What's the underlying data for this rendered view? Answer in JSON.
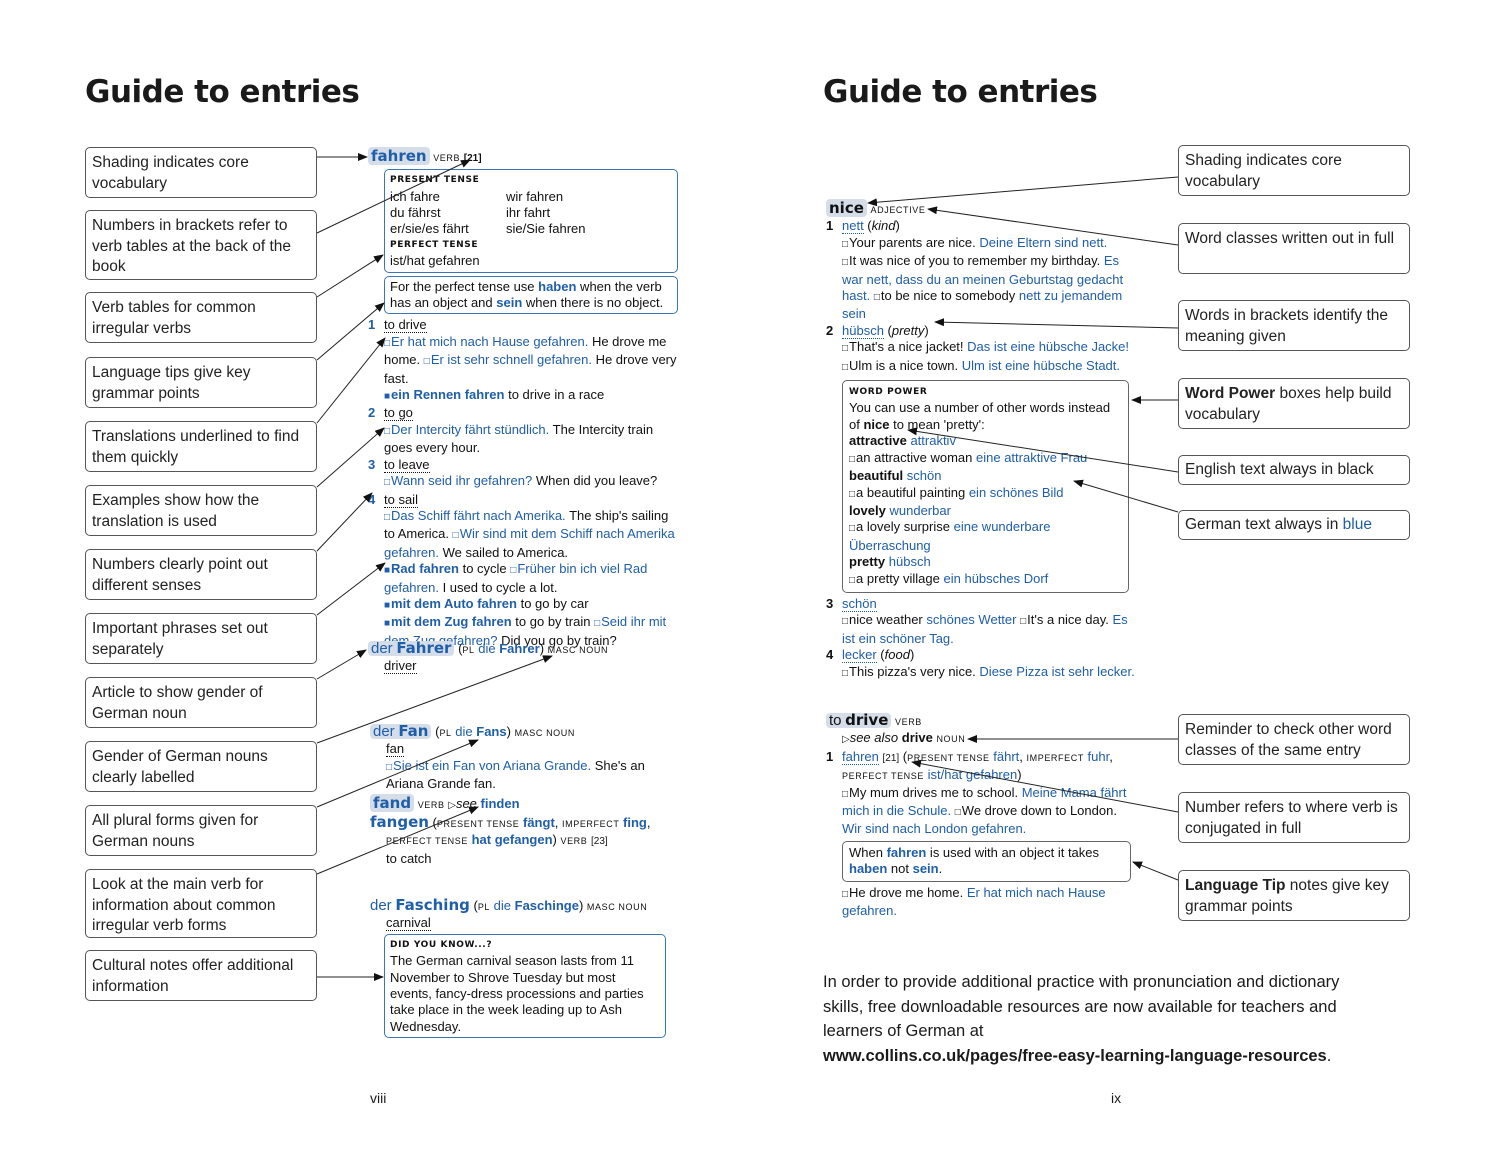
{
  "left_page": {
    "title": "Guide to entries",
    "page_number": "viii",
    "callouts": [
      "Shading indicates core vocabulary",
      "Numbers in brackets refer to verb tables at  the back of the book",
      "Verb tables for common irregular verbs",
      "Language tips give key grammar points",
      "Translations underlined to find them quickly",
      "Examples show how the translation is used",
      "Numbers clearly point out different senses",
      "Important phrases set out separately",
      "Article to show gender of German noun",
      "Gender of German nouns clearly labelled",
      "All plural forms given for German nouns",
      "Look at the main verb for information about common irregular verb forms",
      "Cultural notes offer additional information"
    ],
    "fahren": {
      "headword": "fahren",
      "pos": "VERB",
      "table_ref": "[21]",
      "present_label": "PRESENT TENSE",
      "present": [
        [
          "ich fahre",
          "wir fahren"
        ],
        [
          "du fährst",
          "ihr fahrt"
        ],
        [
          "er/sie/es fährt",
          "sie/Sie fahren"
        ]
      ],
      "perfect_label": "PERFECT TENSE",
      "perfect": "ist/hat gefahren",
      "tip": [
        "For the perfect tense use ",
        "haben",
        " when the verb has an object and ",
        "sein",
        " when there is no object."
      ],
      "senses": [
        {
          "n": "1",
          "tr": "to drive",
          "ex": [
            [
              "Er hat mich nach Hause gefahren.",
              "He drove me home."
            ],
            [
              "Er ist sehr schnell gefahren.",
              "He drove very fast."
            ]
          ],
          "phr": [
            [
              "ein Rennen fahren",
              "to drive in a race"
            ]
          ]
        },
        {
          "n": "2",
          "tr": "to go",
          "ex": [
            [
              "Der Intercity fährt stündlich.",
              "The Intercity train goes every hour."
            ]
          ]
        },
        {
          "n": "3",
          "tr": "to leave",
          "ex": [
            [
              "Wann seid ihr gefahren?",
              "When did you leave?"
            ]
          ]
        },
        {
          "n": "4",
          "tr": "to sail",
          "ex": [
            [
              "Das Schiff fährt nach Amerika.",
              "The ship's sailing to America."
            ],
            [
              "Wir sind mit dem Schiff nach Amerika gefahren.",
              "We sailed to America."
            ]
          ]
        }
      ],
      "phrases": [
        {
          "de": "Rad fahren",
          "en": "to cycle",
          "ex_de": "Früher bin ich viel Rad gefahren.",
          "ex_en": "I used to cycle a lot."
        },
        {
          "de": "mit dem Auto fahren",
          "en": "to go by car"
        },
        {
          "de": "mit dem Zug fahren",
          "en": "to go by train",
          "ex_de": "Seid ihr mit dem Zug gefahren?",
          "ex_en": "Did you go by train?"
        }
      ]
    },
    "fahrer": {
      "article": "der",
      "headword": "Fahrer",
      "pl_label": "PL",
      "pl": "die",
      "pl_word": "Fahrer",
      "gender": "MASC NOUN",
      "tr": "driver"
    },
    "fan": {
      "article": "der",
      "headword": "Fan",
      "pl_label": "PL",
      "pl": "die",
      "pl_word": "Fans",
      "gender": "MASC NOUN",
      "tr": "fan",
      "ex_de": "Sie ist ein Fan von Ariana Grande.",
      "ex_en": "She's an Ariana Grande fan."
    },
    "fand": {
      "headword": "fand",
      "pos": "VERB",
      "see": "see",
      "target": "finden"
    },
    "fangen": {
      "headword": "fangen",
      "pres_label": "PRESENT TENSE",
      "pres": "fängt",
      "imp_label": "IMPERFECT",
      "imp": "fing",
      "perf_label": "PERFECT TENSE",
      "perf": "hat gefangen",
      "pos": "VERB",
      "ref": "[23]",
      "tr": "to catch"
    },
    "fasching": {
      "article": "der",
      "headword": "Fasching",
      "pl_label": "PL",
      "pl": "die",
      "pl_word": "Faschinge",
      "gender": "MASC NOUN",
      "tr": "carnival",
      "did_you_know_label": "DID YOU KNOW...?",
      "did_you_know": "The German carnival season lasts from 11 November to Shrove Tuesday but most events, fancy-dress processions and parties take place in the week leading up to Ash Wednesday."
    }
  },
  "right_page": {
    "title": "Guide to entries",
    "page_number": "ix",
    "callouts": [
      {
        "bold": "",
        "text": "Shading indicates core vocabulary"
      },
      {
        "bold": "",
        "text": "Word classes written out in full"
      },
      {
        "bold": "",
        "text": "Words in brackets identify the meaning given"
      },
      {
        "bold": "Word Power",
        "text": " boxes help build vocabulary"
      },
      {
        "bold": "",
        "text": "English text always in black"
      },
      {
        "bold": "",
        "text": "German text always in ",
        "blue": "blue"
      },
      {
        "bold": "",
        "text": "Reminder to check other word classes of the same entry"
      },
      {
        "bold": "",
        "text": "Number refers to where verb is conjugated in full"
      },
      {
        "bold": "Language Tip",
        "text": " notes give key grammar points"
      }
    ],
    "nice": {
      "headword": "nice",
      "pos": "ADJECTIVE",
      "s1": {
        "n": "1",
        "tr": "nett",
        "note": "kind",
        "ex": [
          [
            "Your parents are nice.",
            "Deine Eltern sind nett."
          ],
          [
            "It was nice of you to remember my birthday.",
            "Es war nett, dass du an meinen Geburtstag gedacht hast."
          ],
          [
            "to be nice to somebody",
            "nett zu jemandem sein"
          ]
        ]
      },
      "s2": {
        "n": "2",
        "tr": "hübsch",
        "note": "pretty",
        "ex": [
          [
            "That's a nice jacket!",
            "Das ist eine hübsche Jacke!"
          ],
          [
            "Ulm is a nice town.",
            "Ulm ist eine hübsche Stadt."
          ]
        ]
      },
      "word_power": {
        "label": "WORD POWER",
        "intro_a": "You can use a number of other words instead of ",
        "intro_b": "nice",
        "intro_c": " to mean 'pretty':",
        "items": [
          {
            "en": "attractive",
            "de": "attraktiv",
            "ex_en": "an attractive woman",
            "ex_de": "eine attraktive Frau"
          },
          {
            "en": "beautiful",
            "de": "schön",
            "ex_en": "a beautiful painting",
            "ex_de": "ein schönes Bild"
          },
          {
            "en": "lovely",
            "de": "wunderbar",
            "ex_en": "a lovely surprise",
            "ex_de": "eine wunderbare Überraschung"
          },
          {
            "en": "pretty",
            "de": "hübsch",
            "ex_en": "a pretty village",
            "ex_de": "ein hübsches Dorf"
          }
        ]
      },
      "s3": {
        "n": "3",
        "tr": "schön",
        "ex": [
          [
            "nice weather",
            "schönes Wetter"
          ],
          [
            "It's a nice day.",
            "Es ist ein schöner Tag."
          ]
        ]
      },
      "s4": {
        "n": "4",
        "tr": "lecker",
        "note": "food",
        "ex": [
          [
            "This pizza's very nice.",
            "Diese Pizza ist sehr lecker."
          ]
        ]
      }
    },
    "drive": {
      "to": "to",
      "headword": "drive",
      "pos": "VERB",
      "see_also": "see also",
      "see_word": "drive",
      "see_pos": "NOUN",
      "n": "1",
      "tr": "fahren",
      "ref": "[21]",
      "pres_label": "PRESENT TENSE",
      "pres": "fährt",
      "imp_label": "IMPERFECT",
      "imp": "fuhr",
      "perf_label": "PERFECT TENSE",
      "perf": "ist/hat gefahren",
      "ex": [
        [
          "My mum drives me to school.",
          "Meine Mama fährt mich in die Schule."
        ],
        [
          "We drove down to London.",
          "Wir sind nach London gefahren."
        ]
      ],
      "tip": {
        "a": "When ",
        "b": "fahren",
        "c": " is used with an object it takes ",
        "d": "haben",
        "e": " not ",
        "f": "sein",
        "g": "."
      },
      "ex2": [
        "He drove me home.",
        "Er hat mich nach Hause gefahren."
      ]
    },
    "footer": {
      "text": "In order to provide additional practice with pronunciation and dictionary skills, free downloadable resources are now available for teachers and learners of German at",
      "url": "www.collins.co.uk/pages/free-easy-learning-language-resources",
      "end": "."
    }
  }
}
